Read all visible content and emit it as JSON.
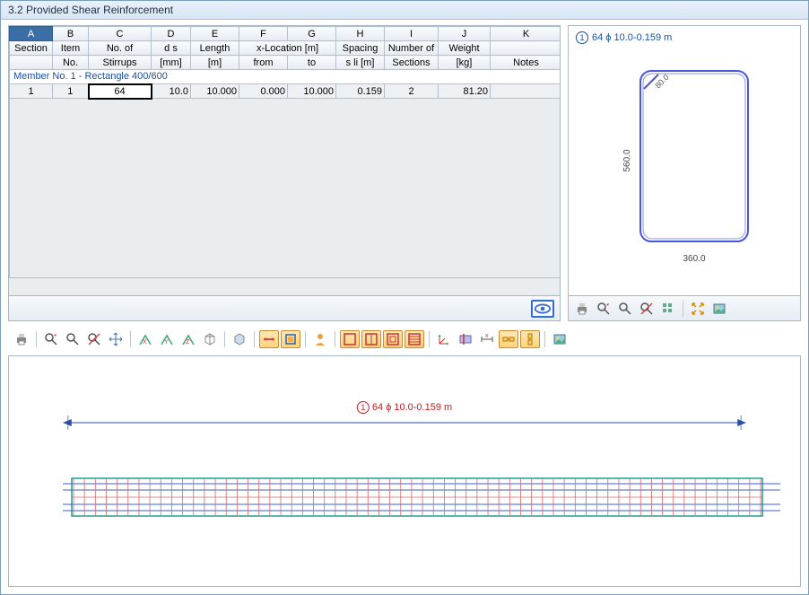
{
  "title": "3.2  Provided Shear Reinforcement",
  "columns_letters": [
    "A",
    "B",
    "C",
    "D",
    "E",
    "F",
    "G",
    "H",
    "I",
    "J",
    "K"
  ],
  "headers_row1": [
    "Section",
    "Item",
    "No. of",
    "d s",
    "Length",
    "x-Location [m]",
    "",
    "Spacing",
    "Number of",
    "Weight",
    ""
  ],
  "headers_row2": [
    "",
    "No.",
    "Stirrups",
    "[mm]",
    "[m]",
    "from",
    "to",
    "s li [m]",
    "Sections",
    "[kg]",
    "Notes"
  ],
  "merge_xloc": "x-Location [m]",
  "member_row": "Member No. 1  -  Rectangle 400/600",
  "data_row": {
    "section": "1",
    "item": "1",
    "stirrups": "64",
    "ds": "10.0",
    "length": "10.000",
    "xfrom": "0.000",
    "xto": "10.000",
    "spacing": "0.159",
    "nsect": "2",
    "weight": "81.20",
    "notes": ""
  },
  "section_preview": {
    "label": "64 ϕ 10.0-0.159 m",
    "circ": "1",
    "dim_v": "560.0",
    "dim_h": "360.0",
    "dim_diag": "80.0"
  },
  "beam_view": {
    "label": "64 ϕ 10.0-0.159 m",
    "circ": "1"
  },
  "colors": {
    "blue": "#1a4fa0",
    "red": "#c02020",
    "beam_outline": "#1fa090",
    "stirrup": "#d06a6a",
    "rebar": "#3a5fd0"
  }
}
